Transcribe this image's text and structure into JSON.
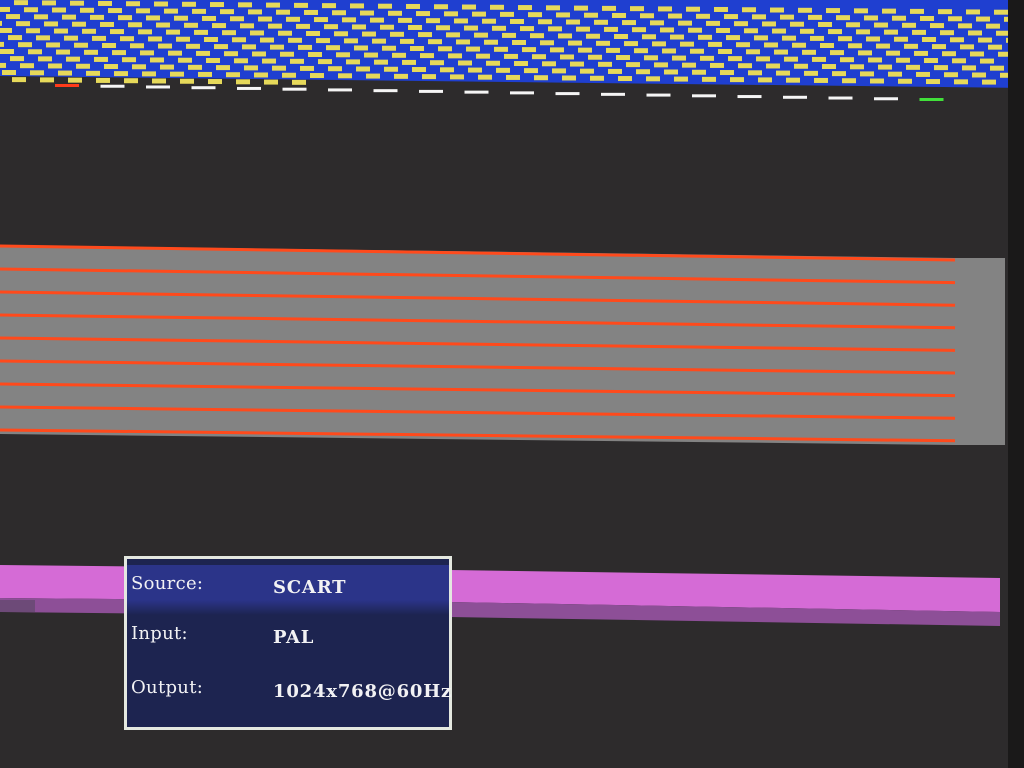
{
  "colors": {
    "background": "#2d2b2c",
    "checker_blue": "#1f3fd0",
    "checker_yellow": "#e6d95a",
    "stripe_gray": "#838383",
    "stripe_red": "#ff4a1c",
    "magenta": "#d56bd6",
    "osd_panel": "#1d2450",
    "osd_highlight": "#2b3489",
    "osd_border": "#e4e8e0",
    "dash_white": "#f5f5f5",
    "dash_red": "#ff3b1a",
    "dash_green": "#41e03a"
  },
  "osd": {
    "rows": [
      {
        "label": "Source:",
        "value": "SCART"
      },
      {
        "label": "Input:",
        "value": "PAL"
      },
      {
        "label": "Output:",
        "value": "1024x768@60Hz"
      }
    ]
  }
}
